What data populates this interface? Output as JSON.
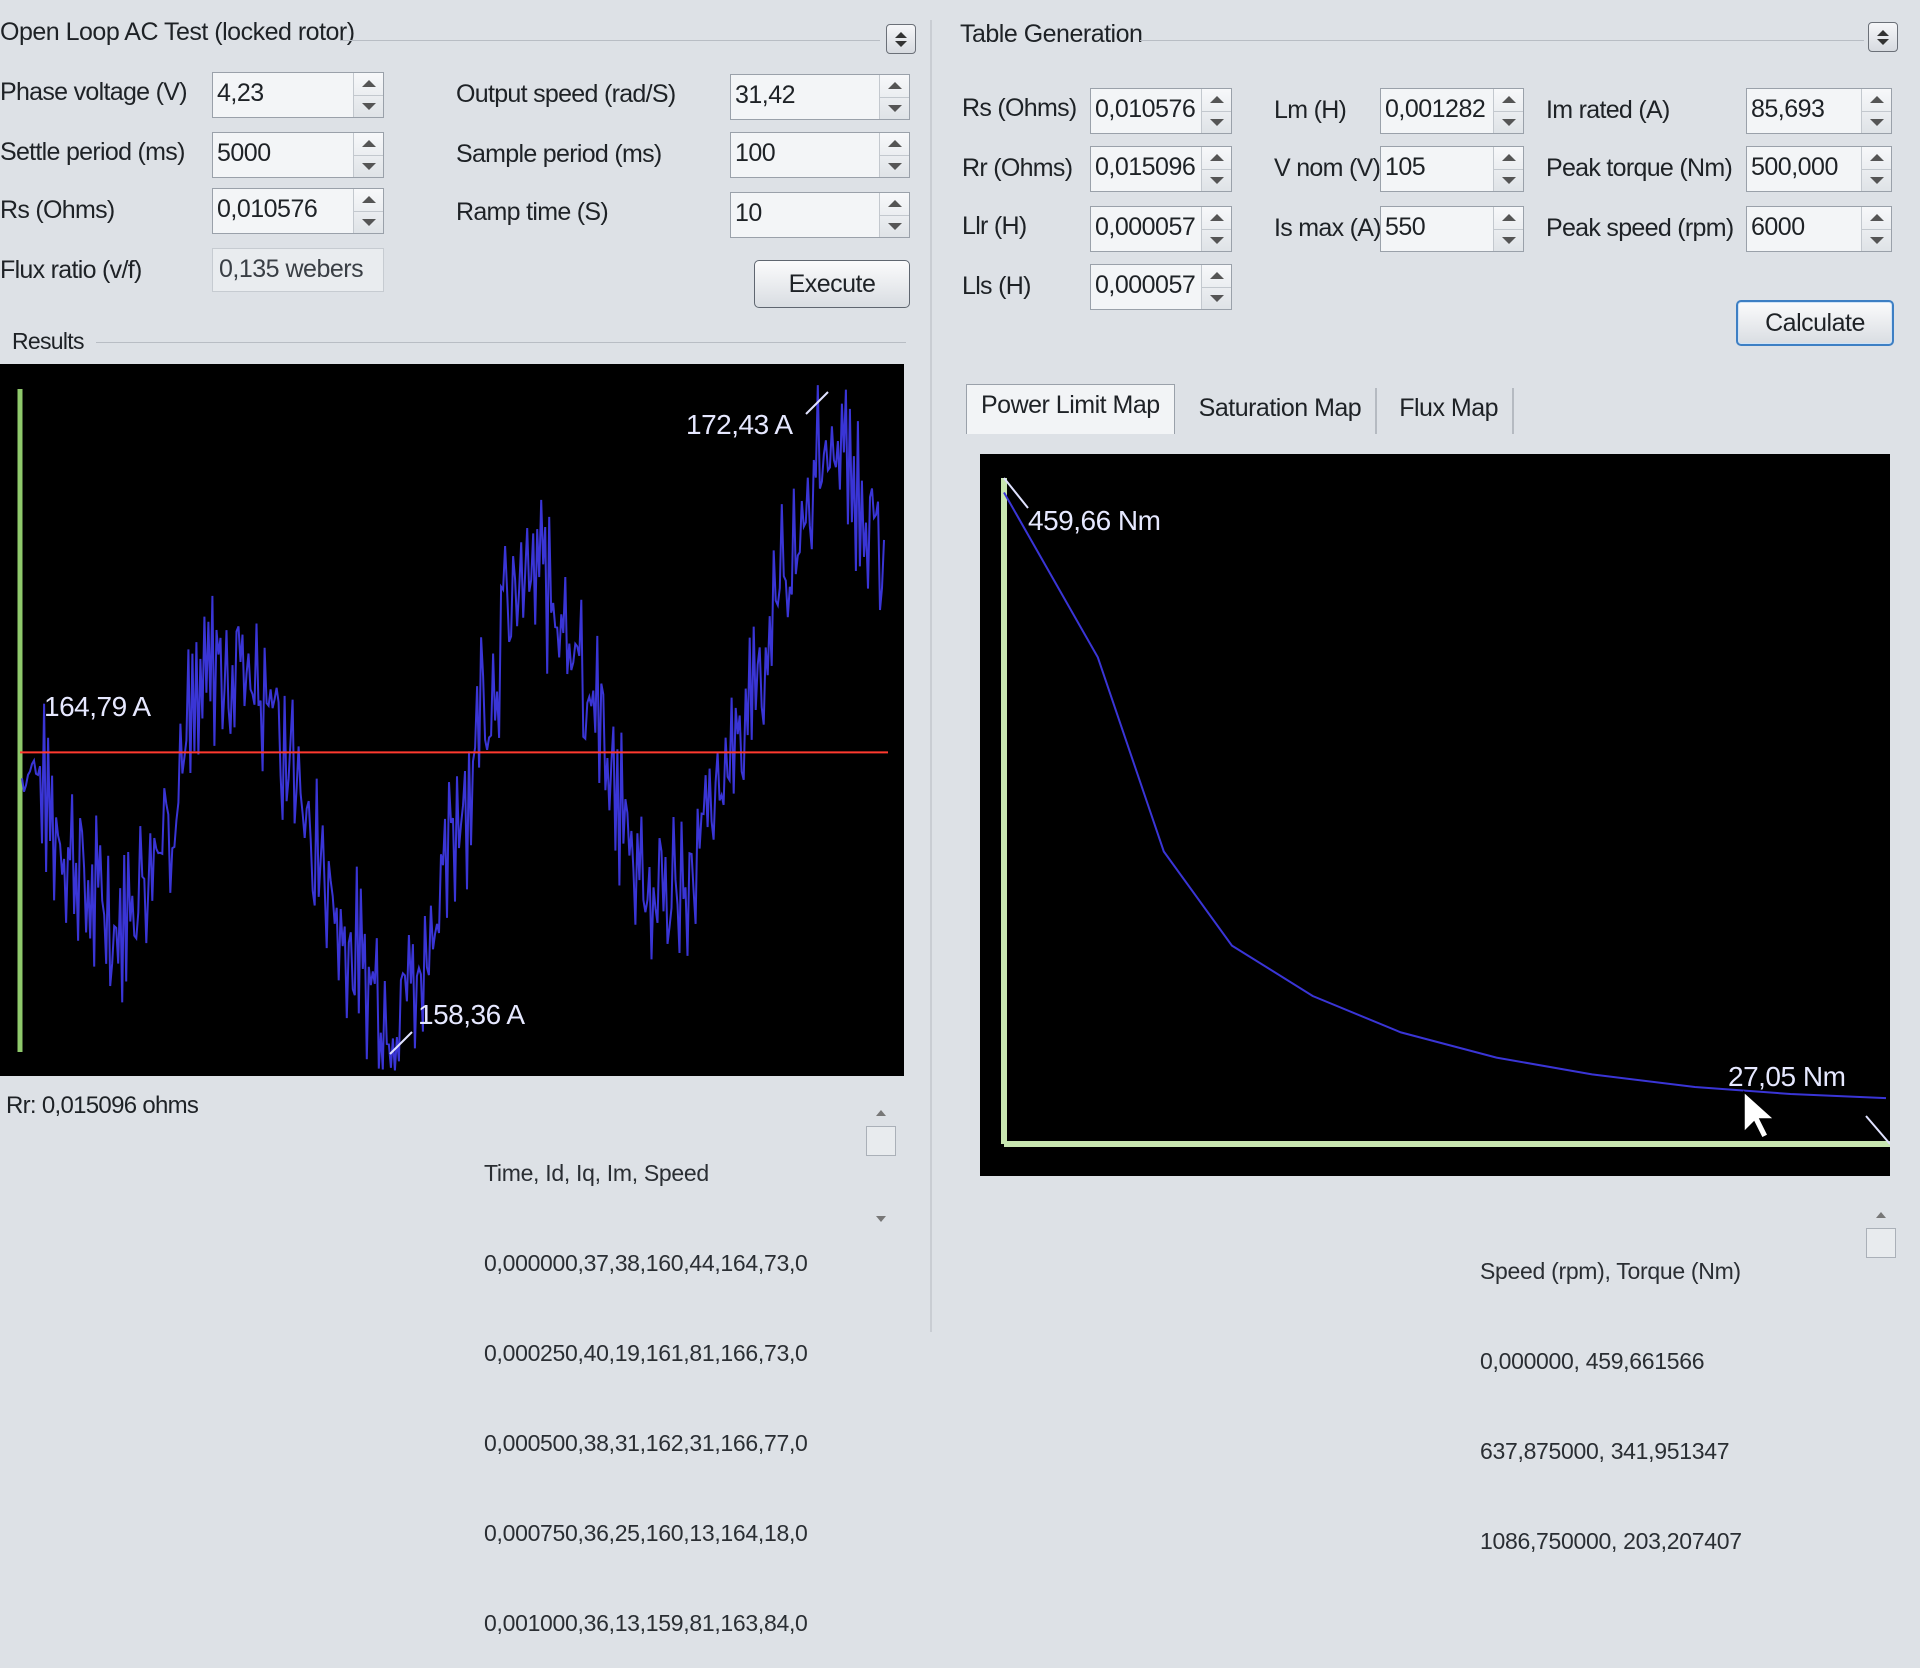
{
  "left_panel": {
    "title": "Open Loop AC Test (locked rotor)",
    "fields": {
      "phase_voltage": {
        "label": "Phase voltage (V)",
        "value": "4,23"
      },
      "settle_period": {
        "label": "Settle period (ms)",
        "value": "5000"
      },
      "rs": {
        "label": "Rs (Ohms)",
        "value": "0,010576"
      },
      "flux_ratio": {
        "label": "Flux ratio (v/f)",
        "value": "0,135 webers"
      },
      "output_speed": {
        "label": "Output speed (rad/S)",
        "value": "31,42"
      },
      "sample_period": {
        "label": "Sample period (ms)",
        "value": "100"
      },
      "ramp_time": {
        "label": "Ramp time (S)",
        "value": "10"
      }
    },
    "execute_label": "Execute",
    "results_label": "Results",
    "chart": {
      "annotations": {
        "start": "164,79 A",
        "max": "172,43 A",
        "min": "158,36 A"
      },
      "series_color": "#3a35d6",
      "reference_color": "#ff3a2f",
      "axis_color": "#8fc96b"
    },
    "rr_result": "Rr: 0,015096 ohms",
    "data_header": "Time, Id, Iq, Im, Speed",
    "data_rows": [
      "0,000000,37,38,160,44,164,73,0",
      "0,000250,40,19,161,81,166,73,0",
      "0,000500,38,31,162,31,166,77,0",
      "0,000750,36,25,160,13,164,18,0",
      "0,001000,36,13,159,81,163,84,0"
    ]
  },
  "right_panel": {
    "title": "Table Generation",
    "fields": {
      "rs": {
        "label": "Rs (Ohms)",
        "value": "0,010576"
      },
      "rr": {
        "label": "Rr (Ohms)",
        "value": "0,015096"
      },
      "llr": {
        "label": "Llr (H)",
        "value": "0,000057"
      },
      "lls": {
        "label": "Lls (H)",
        "value": "0,000057"
      },
      "lm": {
        "label": "Lm (H)",
        "value": "0,001282"
      },
      "v_nom": {
        "label": "V nom (V)",
        "value": "105"
      },
      "is_max": {
        "label": "Is max (A)",
        "value": "550"
      },
      "im_rated": {
        "label": "Im rated (A)",
        "value": "85,693"
      },
      "peak_torque": {
        "label": "Peak torque (Nm)",
        "value": "500,000"
      },
      "peak_speed": {
        "label": "Peak speed (rpm)",
        "value": "6000"
      }
    },
    "calculate_label": "Calculate",
    "tabs": [
      "Power Limit Map",
      "Saturation Map",
      "Flux Map"
    ],
    "active_tab": 0,
    "chart": {
      "annotations": {
        "start": "459,66 Nm",
        "end": "27,05 Nm"
      },
      "series_color": "#3a35d6",
      "axis_color": "#c8e6b0"
    },
    "data_header": "Speed (rpm), Torque (Nm)",
    "data_rows": [
      "0,000000, 459,661566",
      "637,875000, 341,951347",
      "1086,750000, 203,207407"
    ]
  },
  "chart_data": [
    {
      "type": "line",
      "y_unit": "A",
      "series": [
        {
          "values": [
            164.79,
            163.5,
            162.2,
            161.0,
            160.6,
            161.8,
            163.6,
            165.6,
            166.9,
            167.1,
            166.2,
            164.4,
            162.3,
            160.4,
            159.0,
            158.4,
            159.2,
            161.3,
            164.0,
            166.7,
            168.6,
            169.3,
            168.4,
            166.3,
            163.9,
            162.0,
            161.2,
            161.6,
            163.0,
            165.0,
            167.2,
            169.4,
            171.3,
            172.43,
            171.5,
            169.0
          ]
        },
        {
          "values": [
            164.79,
            164.79
          ]
        }
      ],
      "annotations": [
        {
          "text": "164,79 A",
          "y": 164.79
        },
        {
          "text": "172,43 A",
          "y": 172.43
        },
        {
          "text": "158,36 A",
          "y": 158.36
        }
      ]
    },
    {
      "type": "line",
      "x_label": "Speed (rpm)",
      "y_label": "Torque (Nm)",
      "x": [
        0,
        637.875,
        1086.75,
        1550,
        2100,
        2700,
        3350,
        4000,
        4700,
        5350,
        6000
      ],
      "series": [
        {
          "values": [
            459.66,
            341.95,
            203.21,
            136,
            100,
            74,
            56,
            44,
            35,
            30,
            27.05
          ]
        }
      ],
      "annotations": [
        {
          "text": "459,66 Nm",
          "x": 0,
          "y": 459.66
        },
        {
          "text": "27,05 Nm",
          "x": 6000,
          "y": 27.05
        }
      ]
    }
  ]
}
